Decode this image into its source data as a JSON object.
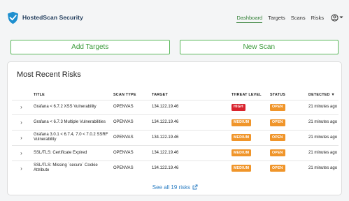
{
  "navbar": {
    "brand": "HostedScan Security",
    "links": [
      {
        "label": "Dashboard",
        "active": true
      },
      {
        "label": "Targets",
        "active": false
      },
      {
        "label": "Scans",
        "active": false
      },
      {
        "label": "Risks",
        "active": false
      }
    ],
    "user_icon": "user-circle-icon"
  },
  "actions": {
    "add_targets": "Add Targets",
    "new_scan": "New Scan"
  },
  "risks": {
    "title": "Most Recent Risks",
    "columns": {
      "title": "TITLE",
      "scan_type": "SCAN TYPE",
      "target": "TARGET",
      "threat_level": "THREAT LEVEL",
      "status": "STATUS",
      "detected": "DETECTED ▼"
    },
    "rows": [
      {
        "title": "Grafana < 6.7.2 XSS Vulnerability",
        "scan_type": "OPENVAS",
        "target": "134.122.19.46",
        "threat": "HIGH",
        "status": "OPEN",
        "detected": "21 minutes ago"
      },
      {
        "title": "Grafana < 6.7.3 Multiple Vulnerabilities",
        "scan_type": "OPENVAS",
        "target": "134.122.19.46",
        "threat": "MEDIUM",
        "status": "OPEN",
        "detected": "21 minutes ago"
      },
      {
        "title": "Grafana 3.0.1 < 6.7.4, 7.0 < 7.0.2 SSRF Vulnerability",
        "scan_type": "OPENVAS",
        "target": "134.122.19.46",
        "threat": "MEDIUM",
        "status": "OPEN",
        "detected": "21 minutes ago"
      },
      {
        "title": "SSL/TLS: Certificate Expired",
        "scan_type": "OPENVAS",
        "target": "134.122.19.46",
        "threat": "MEDIUM",
        "status": "OPEN",
        "detected": "21 minutes ago"
      },
      {
        "title": "SSL/TLS: Missing `secure` Cookie Attribute",
        "scan_type": "OPENVAS",
        "target": "134.122.19.46",
        "threat": "MEDIUM",
        "status": "OPEN",
        "detected": "21 minutes ago"
      }
    ],
    "see_all": "See all 19 risks"
  },
  "colors": {
    "accent_green": "#3a9a3a",
    "high": "#d9232d",
    "medium": "#f0952a",
    "open": "#f0952a",
    "link": "#2c7ec3",
    "brand_blue": "#1e8fcf"
  }
}
